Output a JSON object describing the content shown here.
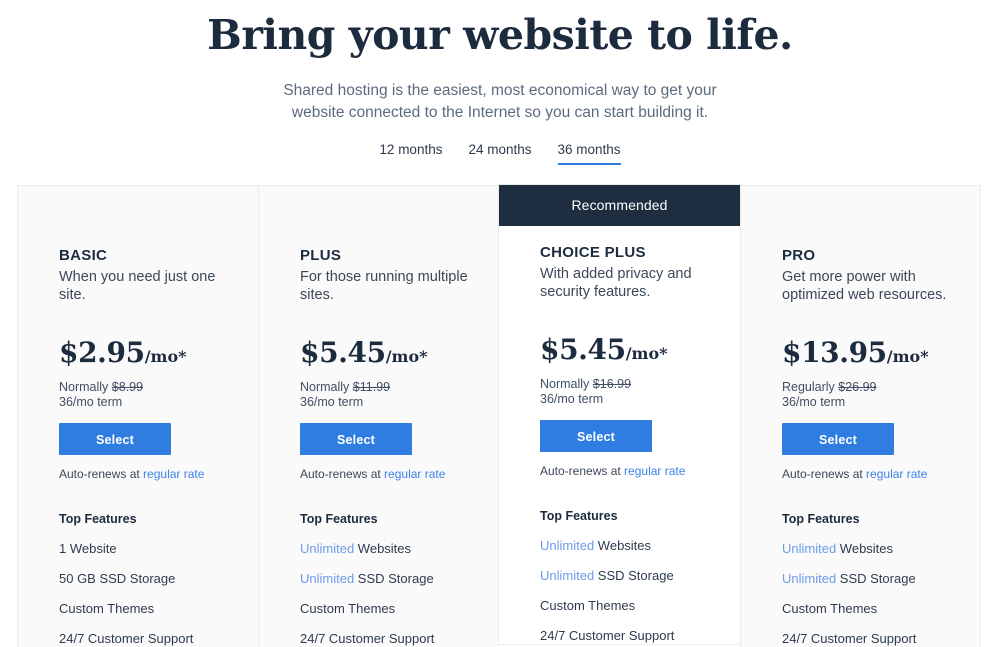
{
  "header": {
    "title": "Bring your website to life.",
    "subtitle": "Shared hosting is the easiest, most economical way to get your website connected to the Internet so you can start building it."
  },
  "terms": {
    "options": [
      {
        "label": "12 months",
        "active": false
      },
      {
        "label": "24 months",
        "active": false
      },
      {
        "label": "36 months",
        "active": true
      }
    ]
  },
  "labels": {
    "features_title": "Top Features",
    "select": "Select",
    "renew_prefix": "Auto-renews at ",
    "renew_link": "regular rate",
    "recommended": "Recommended"
  },
  "colors": {
    "accent_blue": "#2f7de1",
    "link_blue": "#3b82e8",
    "highlight_blue": "#6d9bea",
    "banner_navy": "#1e2d40",
    "heading_navy": "#1d2b3f",
    "card_bg": "#fafafa"
  },
  "plans": [
    {
      "name": "BASIC",
      "description": "When you need just one site.",
      "price": "$2.95",
      "per": "/mo*",
      "compare_label": "Normally ",
      "compare_price": "$8.99",
      "term_note": "36/mo term",
      "recommended": false,
      "features": [
        {
          "highlight": "",
          "text": "1 Website"
        },
        {
          "highlight": "",
          "text": "50 GB SSD Storage"
        },
        {
          "highlight": "",
          "text": "Custom Themes"
        },
        {
          "highlight": "",
          "text": "24/7 Customer Support"
        }
      ]
    },
    {
      "name": "PLUS",
      "description": "For those running multiple sites.",
      "price": "$5.45",
      "per": "/mo*",
      "compare_label": "Normally ",
      "compare_price": "$11.99",
      "term_note": "36/mo term",
      "recommended": false,
      "features": [
        {
          "highlight": "Unlimited",
          "text": " Websites"
        },
        {
          "highlight": "Unlimited",
          "text": " SSD Storage"
        },
        {
          "highlight": "",
          "text": "Custom Themes"
        },
        {
          "highlight": "",
          "text": "24/7 Customer Support"
        }
      ]
    },
    {
      "name": "CHOICE PLUS",
      "description": "With added privacy and security features.",
      "price": "$5.45",
      "per": "/mo*",
      "compare_label": "Normally ",
      "compare_price": "$16.99",
      "term_note": "36/mo term",
      "recommended": true,
      "features": [
        {
          "highlight": "Unlimited",
          "text": " Websites"
        },
        {
          "highlight": "Unlimited",
          "text": " SSD Storage"
        },
        {
          "highlight": "",
          "text": "Custom Themes"
        },
        {
          "highlight": "",
          "text": "24/7 Customer Support"
        }
      ]
    },
    {
      "name": "PRO",
      "description": "Get more power with optimized web resources.",
      "price": "$13.95",
      "per": "/mo*",
      "compare_label": "Regularly ",
      "compare_price": "$26.99",
      "term_note": "36/mo term",
      "recommended": false,
      "features": [
        {
          "highlight": "Unlimited",
          "text": " Websites"
        },
        {
          "highlight": "Unlimited",
          "text": " SSD Storage"
        },
        {
          "highlight": "",
          "text": "Custom Themes"
        },
        {
          "highlight": "",
          "text": "24/7 Customer Support"
        }
      ]
    }
  ]
}
